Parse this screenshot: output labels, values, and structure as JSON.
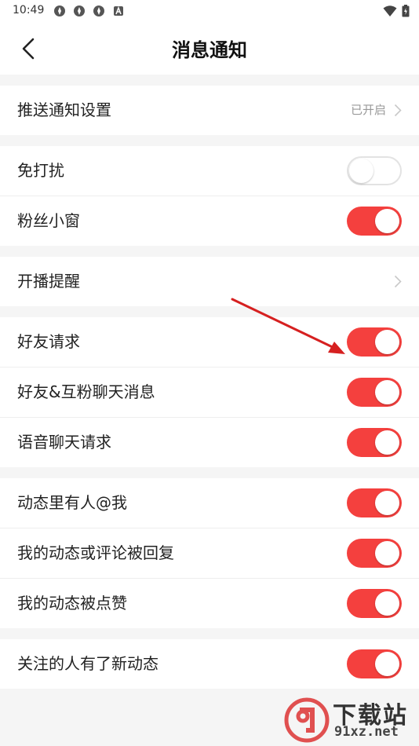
{
  "status_bar": {
    "time": "10:49",
    "left_icons": [
      "app-icon",
      "app-icon",
      "app-icon",
      "a-badge-icon"
    ],
    "right_icons": [
      "wifi-icon",
      "battery-icon"
    ]
  },
  "header": {
    "title": "消息通知",
    "back_icon": "chevron-left-icon"
  },
  "groups": [
    {
      "rows": [
        {
          "label": "推送通知设置",
          "value": "已开启",
          "type": "link"
        }
      ]
    },
    {
      "rows": [
        {
          "label": "免打扰",
          "type": "toggle",
          "on": false
        },
        {
          "label": "粉丝小窗",
          "type": "toggle",
          "on": true
        }
      ]
    },
    {
      "rows": [
        {
          "label": "开播提醒",
          "type": "link"
        }
      ]
    },
    {
      "rows": [
        {
          "label": "好友请求",
          "type": "toggle",
          "on": true
        },
        {
          "label": "好友&互粉聊天消息",
          "type": "toggle",
          "on": true
        },
        {
          "label": "语音聊天请求",
          "type": "toggle",
          "on": true
        }
      ]
    },
    {
      "rows": [
        {
          "label": "动态里有人@我",
          "type": "toggle",
          "on": true
        },
        {
          "label": "我的动态或评论被回复",
          "type": "toggle",
          "on": true
        },
        {
          "label": "我的动态被点赞",
          "type": "toggle",
          "on": true
        }
      ]
    },
    {
      "rows": [
        {
          "label": "关注的人有了新动态",
          "type": "toggle",
          "on": true
        }
      ]
    }
  ],
  "colors": {
    "toggle_on": "#f4403e",
    "toggle_off_border": "#e3e3e3",
    "annotation_arrow": "#d62020",
    "background": "#f5f5f5"
  },
  "watermark": {
    "title": "下载站",
    "url": "91xz.net"
  }
}
